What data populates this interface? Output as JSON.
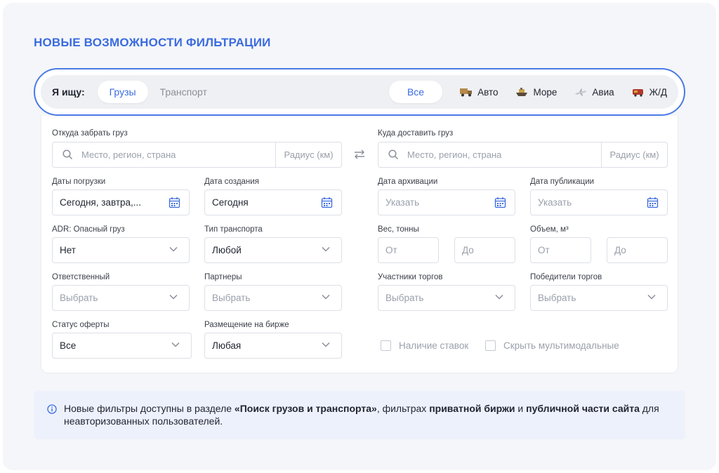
{
  "title": "НОВЫЕ ВОЗМОЖНОСТИ ФИЛЬТРАЦИИ",
  "search_bar": {
    "label": "Я ищу:",
    "types": [
      {
        "label": "Грузы",
        "active": true
      },
      {
        "label": "Транспорт",
        "active": false
      }
    ],
    "all_label": "Все",
    "modes": [
      {
        "label": "Авто",
        "icon": "truck-icon"
      },
      {
        "label": "Море",
        "icon": "ship-icon"
      },
      {
        "label": "Авиа",
        "icon": "plane-icon"
      },
      {
        "label": "Ж/Д",
        "icon": "train-icon"
      }
    ]
  },
  "form": {
    "from": {
      "label": "Откуда забрать груз",
      "placeholder": "Место, регион, страна",
      "radius_placeholder": "Радиус (км)"
    },
    "to": {
      "label": "Куда доставить груз",
      "placeholder": "Место, регион, страна",
      "radius_placeholder": "Радиус (км)"
    },
    "loading_dates": {
      "label": "Даты погрузки",
      "value": "Сегодня, завтра,..."
    },
    "creation_date": {
      "label": "Дата создания",
      "value": "Сегодня"
    },
    "archive_date": {
      "label": "Дата архивации",
      "placeholder": "Указать"
    },
    "publication_date": {
      "label": "Дата публикации",
      "placeholder": "Указать"
    },
    "adr": {
      "label": "ADR: Опасный груз",
      "value": "Нет"
    },
    "transport_type": {
      "label": "Тип транспорта",
      "value": "Любой"
    },
    "weight": {
      "label": "Вес, тонны",
      "from": "От",
      "to": "До"
    },
    "volume": {
      "label": "Объем, м³",
      "from": "От",
      "to": "До"
    },
    "responsible": {
      "label": "Ответственный",
      "placeholder": "Выбрать"
    },
    "partners": {
      "label": "Партнеры",
      "placeholder": "Выбрать"
    },
    "bidders": {
      "label": "Участники торгов",
      "placeholder": "Выбрать"
    },
    "winners": {
      "label": "Победители торгов",
      "placeholder": "Выбрать"
    },
    "offer_status": {
      "label": "Статус оферты",
      "value": "Все"
    },
    "exchange_placement": {
      "label": "Размещение на бирже",
      "value": "Любая"
    },
    "has_bids": {
      "label": "Наличие ставок"
    },
    "hide_multimodal": {
      "label": "Скрыть мультимодальные"
    }
  },
  "info": {
    "t1": "Новые фильтры доступны в разделе ",
    "b1": "«Поиск грузов и транспорта»",
    "t2": ", фильтрах ",
    "b2": "приватной биржи",
    "t3": " и ",
    "b3": "публичной части сайта",
    "t4": " для неавторизованных пользователей."
  },
  "colors": {
    "accent": "#3a6be0",
    "border": "#4a7be6",
    "info_bg": "#edf1fc"
  }
}
